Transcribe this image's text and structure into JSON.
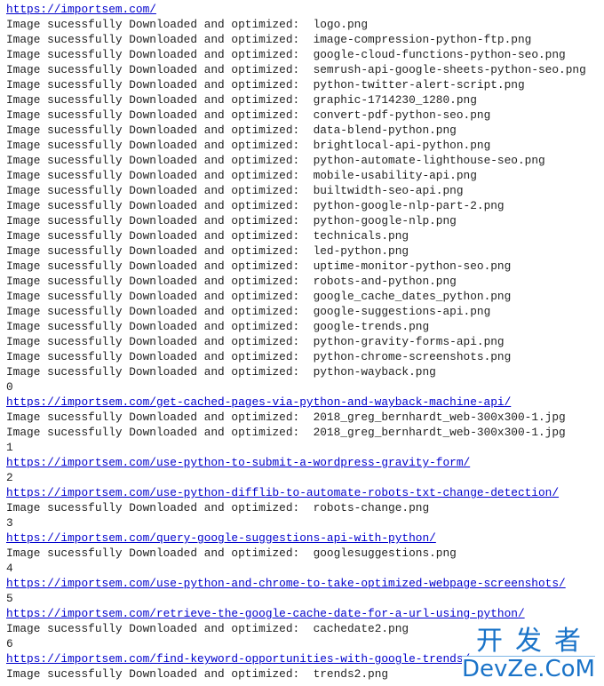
{
  "log": {
    "message_prefix": "Image sucessfully Downloaded and optimized:  ",
    "lines": [
      {
        "type": "link",
        "text": "https://importsem.com/"
      },
      {
        "type": "image",
        "file": "logo.png"
      },
      {
        "type": "image",
        "file": "image-compression-python-ftp.png"
      },
      {
        "type": "image",
        "file": "google-cloud-functions-python-seo.png"
      },
      {
        "type": "image",
        "file": "semrush-api-google-sheets-python-seo.png"
      },
      {
        "type": "image",
        "file": "python-twitter-alert-script.png"
      },
      {
        "type": "image",
        "file": "graphic-1714230_1280.png"
      },
      {
        "type": "image",
        "file": "convert-pdf-python-seo.png"
      },
      {
        "type": "image",
        "file": "data-blend-python.png"
      },
      {
        "type": "image",
        "file": "brightlocal-api-python.png"
      },
      {
        "type": "image",
        "file": "python-automate-lighthouse-seo.png"
      },
      {
        "type": "image",
        "file": "mobile-usability-api.png"
      },
      {
        "type": "image",
        "file": "builtwidth-seo-api.png"
      },
      {
        "type": "image",
        "file": "python-google-nlp-part-2.png"
      },
      {
        "type": "image",
        "file": "python-google-nlp.png"
      },
      {
        "type": "image",
        "file": "technicals.png"
      },
      {
        "type": "image",
        "file": "led-python.png"
      },
      {
        "type": "image",
        "file": "uptime-monitor-python-seo.png"
      },
      {
        "type": "image",
        "file": "robots-and-python.png"
      },
      {
        "type": "image",
        "file": "google_cache_dates_python.png"
      },
      {
        "type": "image",
        "file": "google-suggestions-api.png"
      },
      {
        "type": "image",
        "file": "google-trends.png"
      },
      {
        "type": "image",
        "file": "python-gravity-forms-api.png"
      },
      {
        "type": "image",
        "file": "python-chrome-screenshots.png"
      },
      {
        "type": "image",
        "file": "python-wayback.png"
      },
      {
        "type": "text",
        "text": "0"
      },
      {
        "type": "link",
        "text": "https://importsem.com/get-cached-pages-via-python-and-wayback-machine-api/"
      },
      {
        "type": "image",
        "file": "2018_greg_bernhardt_web-300x300-1.jpg"
      },
      {
        "type": "image",
        "file": "2018_greg_bernhardt_web-300x300-1.jpg"
      },
      {
        "type": "text",
        "text": "1"
      },
      {
        "type": "link",
        "text": "https://importsem.com/use-python-to-submit-a-wordpress-gravity-form/"
      },
      {
        "type": "text",
        "text": "2"
      },
      {
        "type": "link",
        "text": "https://importsem.com/use-python-difflib-to-automate-robots-txt-change-detection/"
      },
      {
        "type": "image",
        "file": "robots-change.png"
      },
      {
        "type": "text",
        "text": "3"
      },
      {
        "type": "link",
        "text": "https://importsem.com/query-google-suggestions-api-with-python/"
      },
      {
        "type": "image",
        "file": "googlesuggestions.png"
      },
      {
        "type": "text",
        "text": "4"
      },
      {
        "type": "link",
        "text": "https://importsem.com/use-python-and-chrome-to-take-optimized-webpage-screenshots/"
      },
      {
        "type": "text",
        "text": "5"
      },
      {
        "type": "link",
        "text": "https://importsem.com/retrieve-the-google-cache-date-for-a-url-using-python/"
      },
      {
        "type": "image",
        "file": "cachedate2.png"
      },
      {
        "type": "text",
        "text": "6"
      },
      {
        "type": "link",
        "text": "https://importsem.com/find-keyword-opportunities-with-google-trends/"
      },
      {
        "type": "image",
        "file": "trends2.png"
      }
    ]
  },
  "watermark": {
    "chinese": "开发者",
    "latin": "DevZe.CoM",
    "color": "#1a73c8"
  },
  "colors": {
    "text": "#222222",
    "link": "#0000cc",
    "background": "#ffffff"
  }
}
